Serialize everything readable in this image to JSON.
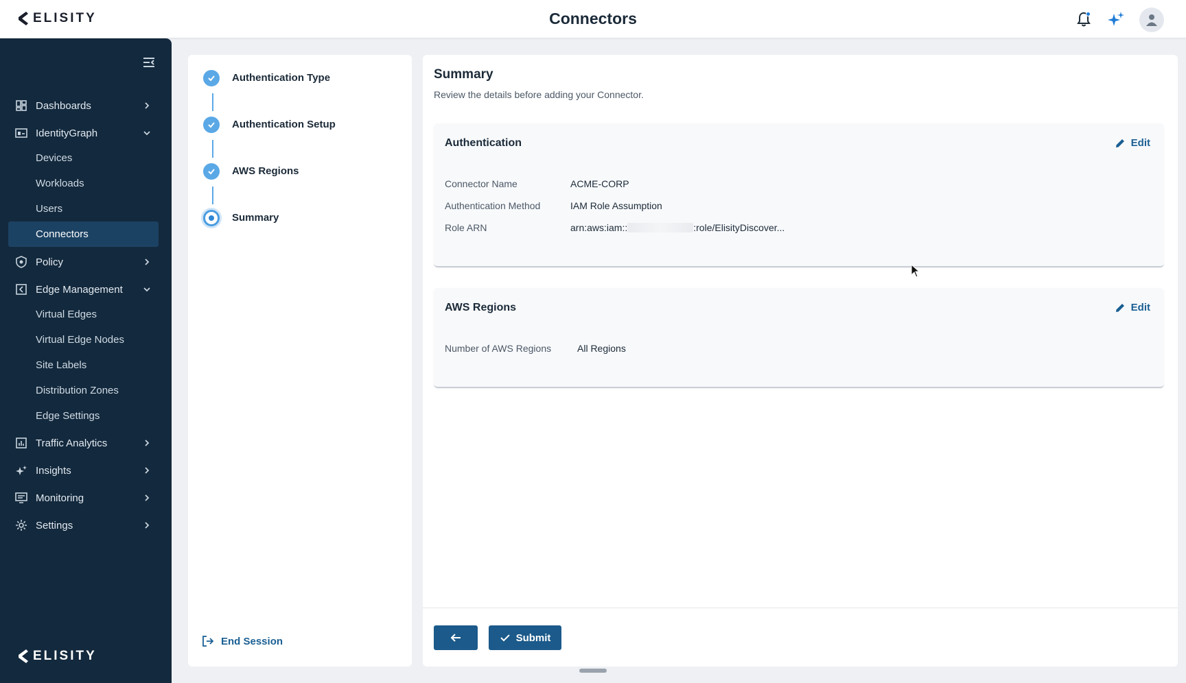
{
  "header": {
    "brand": "ELISITY",
    "title": "Connectors",
    "icons": [
      "bell-icon",
      "sparkle-icon",
      "user-avatar-icon"
    ],
    "notification_dot_color": "#1e7bd6"
  },
  "sidebar": {
    "collapse_icon": "collapse-menu-icon",
    "items": [
      {
        "label": "Dashboards",
        "icon": "dashboard-icon",
        "chevron": "chevron-right"
      },
      {
        "label": "IdentityGraph",
        "icon": "identity-graph-icon",
        "chevron": "chevron-down",
        "children": [
          "Devices",
          "Workloads",
          "Users",
          "Connectors"
        ]
      },
      {
        "label": "Policy",
        "icon": "shield-icon",
        "chevron": "chevron-right"
      },
      {
        "label": "Edge Management",
        "icon": "edge-icon",
        "chevron": "chevron-down",
        "children": [
          "Virtual Edges",
          "Virtual Edge Nodes",
          "Site Labels",
          "Distribution Zones",
          "Edge Settings"
        ]
      },
      {
        "label": "Traffic Analytics",
        "icon": "analytics-icon",
        "chevron": "chevron-right"
      },
      {
        "label": "Insights",
        "icon": "sparkle-icon",
        "chevron": "chevron-right"
      },
      {
        "label": "Monitoring",
        "icon": "monitor-icon",
        "chevron": "chevron-right"
      },
      {
        "label": "Settings",
        "icon": "gear-icon",
        "chevron": "chevron-right"
      }
    ],
    "active_item": "Connectors",
    "footer_brand": "ELISITY",
    "bg_color": "#13293d",
    "active_bg_color": "#1c4263"
  },
  "stepper": {
    "steps": [
      {
        "label": "Authentication Type",
        "state": "complete"
      },
      {
        "label": "Authentication Setup",
        "state": "complete"
      },
      {
        "label": "AWS Regions",
        "state": "complete"
      },
      {
        "label": "Summary",
        "state": "current"
      }
    ],
    "end_session": "End Session",
    "accent_color": "#5aa8e6"
  },
  "main": {
    "title": "Summary",
    "subtitle": "Review the details before adding your Connector.",
    "auth_card": {
      "title": "Authentication",
      "edit_label": "Edit",
      "fields": [
        {
          "key": "Connector Name",
          "value": "ACME-CORP"
        },
        {
          "key": "Authentication Method",
          "value": "IAM Role Assumption"
        },
        {
          "key": "Role ARN",
          "value_prefix": "arn:aws:iam::",
          "value_suffix": ":role/ElisityDiscover..."
        }
      ]
    },
    "regions_card": {
      "title": "AWS Regions",
      "edit_label": "Edit",
      "fields": [
        {
          "key": "Number of AWS Regions",
          "value": "All Regions"
        }
      ]
    },
    "buttons": {
      "back_icon": "arrow-left-icon",
      "submit_label": "Submit",
      "submit_icon": "check-icon",
      "color": "#1b5a8a"
    }
  }
}
